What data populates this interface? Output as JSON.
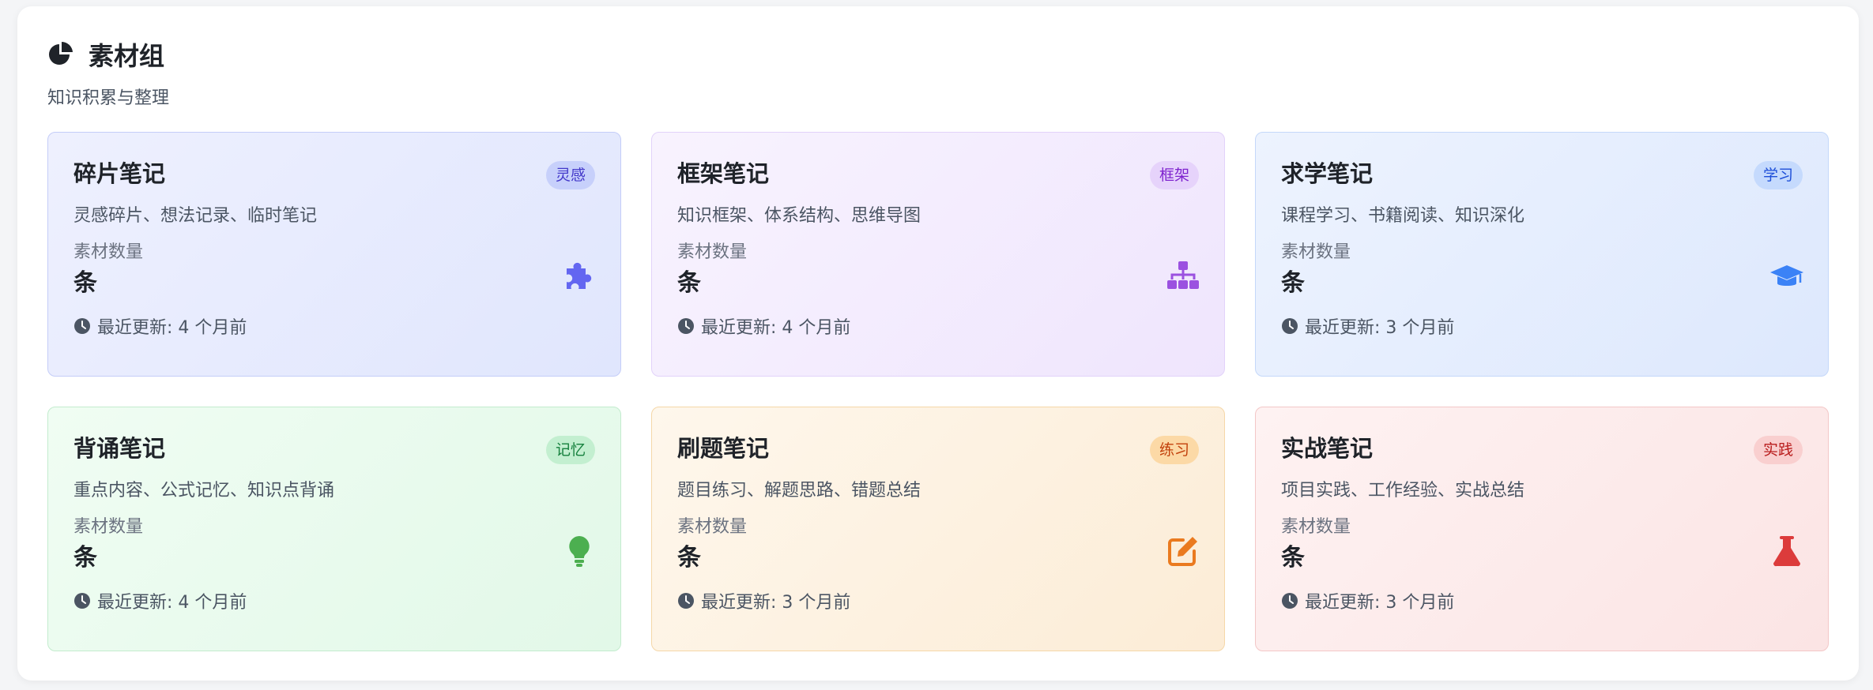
{
  "header": {
    "title": "素材组",
    "subtitle": "知识积累与整理",
    "icon": "pie-chart-icon"
  },
  "common": {
    "count_label": "素材数量",
    "count_unit": "条"
  },
  "cards": [
    {
      "title": "碎片笔记",
      "tag": "灵感",
      "desc": "灵感碎片、想法记录、临时笔记",
      "updated": "最近更新: 4 个月前",
      "icon": "puzzle-icon",
      "accent": "#6366f1"
    },
    {
      "title": "框架笔记",
      "tag": "框架",
      "desc": "知识框架、体系结构、思维导图",
      "updated": "最近更新: 4 个月前",
      "icon": "sitemap-icon",
      "accent": "#9b51e0"
    },
    {
      "title": "求学笔记",
      "tag": "学习",
      "desc": "课程学习、书籍阅读、知识深化",
      "updated": "最近更新: 3 个月前",
      "icon": "graduation-cap-icon",
      "accent": "#3b82f6"
    },
    {
      "title": "背诵笔记",
      "tag": "记忆",
      "desc": "重点内容、公式记忆、知识点背诵",
      "updated": "最近更新: 4 个月前",
      "icon": "lightbulb-icon",
      "accent": "#4caf50"
    },
    {
      "title": "刷题笔记",
      "tag": "练习",
      "desc": "题目练习、解题思路、错题总结",
      "updated": "最近更新: 3 个月前",
      "icon": "edit-icon",
      "accent": "#ea7a1f"
    },
    {
      "title": "实战笔记",
      "tag": "实践",
      "desc": "项目实践、工作经验、实战总结",
      "updated": "最近更新: 3 个月前",
      "icon": "flask-icon",
      "accent": "#dc3b3b"
    }
  ]
}
